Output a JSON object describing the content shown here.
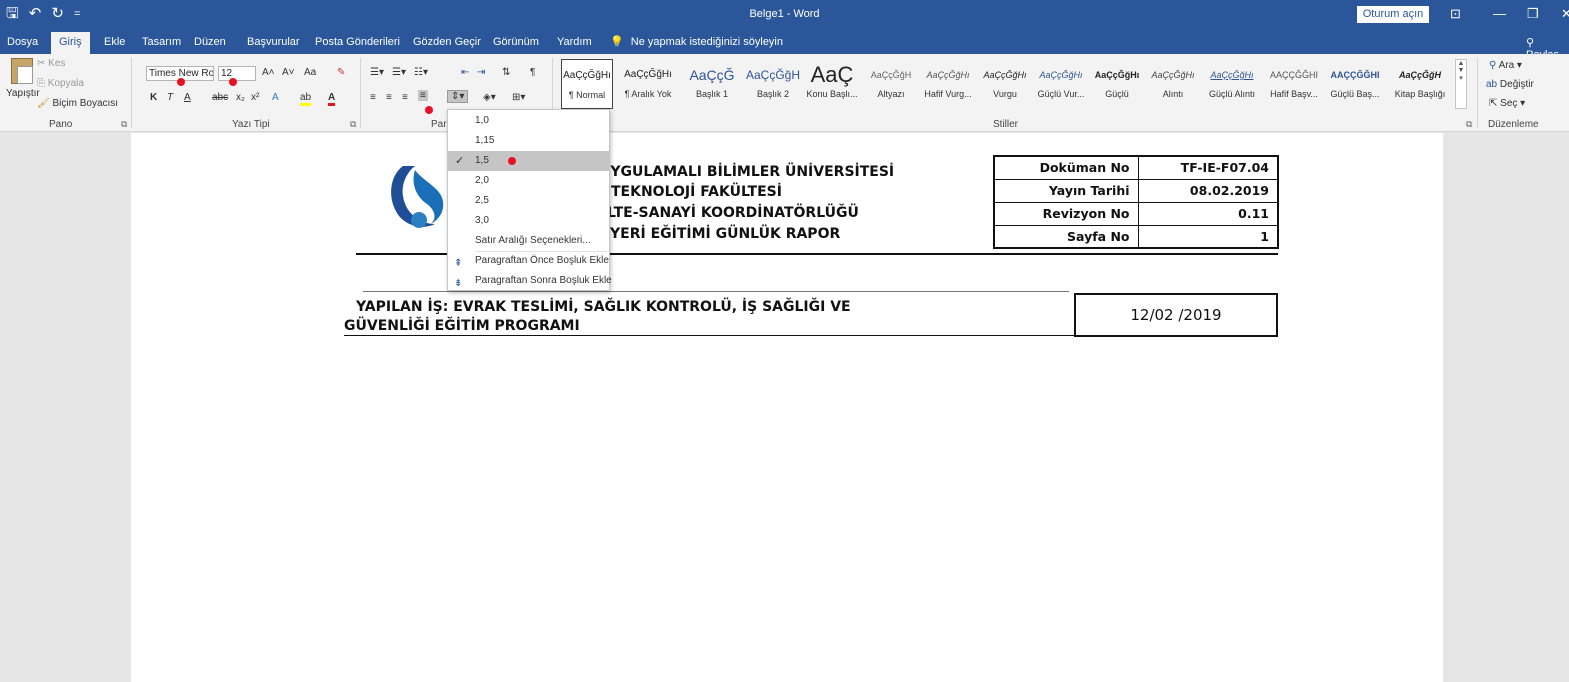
{
  "window": {
    "doc_title": "Belge1  -  Word",
    "signin_label": "Oturum açın",
    "qat": [
      "🖫",
      "↶",
      "↻",
      "="
    ],
    "controls": [
      "⊡",
      "—",
      "❐",
      "✕"
    ]
  },
  "tabs": {
    "items": [
      "Dosya",
      "Giriş",
      "Ekle",
      "Tasarım",
      "Düzen",
      "Başvurular",
      "Posta Gönderileri",
      "Gözden Geçir",
      "Görünüm",
      "Yardım"
    ],
    "active": "Giriş",
    "tell_me": "Ne yapmak istediğinizi söyleyin",
    "share": "Paylaş"
  },
  "clipboard": {
    "paste": "Yapıştır",
    "cut": "Kes",
    "copy": "Kopyala",
    "format_painter": "Biçim Boyacısı",
    "group": "Pano"
  },
  "font": {
    "name": "Times New Ro",
    "size": "12",
    "grow": "A˄",
    "shrink": "A˅",
    "change_case": "Aa",
    "clear": "✎",
    "bold": "K",
    "italic": "T",
    "underline": "A",
    "strike": "abc",
    "sub": "x₂",
    "sup": "x²",
    "effects": "A",
    "highlight": "ab",
    "color": "A",
    "group": "Yazı Tipi"
  },
  "paragraph": {
    "group": "Paragraf",
    "group_visible": "Para"
  },
  "styles": {
    "group": "Stiller",
    "items": [
      {
        "sample": "AaÇçĞğHı",
        "name": "¶ Normal"
      },
      {
        "sample": "AaÇçĞğHı",
        "name": "¶ Aralık Yok"
      },
      {
        "sample": "AaÇçĞ",
        "name": "Başlık 1"
      },
      {
        "sample": "AaÇçĞğH",
        "name": "Başlık 2"
      },
      {
        "sample": "AaÇ",
        "name": "Konu Başlı..."
      },
      {
        "sample": "AaÇçĞğH",
        "name": "Altyazı"
      },
      {
        "sample": "AaÇçĞğHı",
        "name": "Hafif Vurg..."
      },
      {
        "sample": "AaÇçĞğHı",
        "name": "Vurgu"
      },
      {
        "sample": "AaÇçĞğHı",
        "name": "Güçlü Vur..."
      },
      {
        "sample": "AaÇçĞğHı",
        "name": "Güçlü"
      },
      {
        "sample": "AaÇçĞğHı",
        "name": "Alıntı"
      },
      {
        "sample": "AaÇçĞğHı",
        "name": "Güçlü Alıntı"
      },
      {
        "sample": "AAÇÇĞĞHI",
        "name": "Hafif Başv..."
      },
      {
        "sample": "AAÇÇĞĞHI",
        "name": "Güçlü Baş..."
      },
      {
        "sample": "AaÇçĞğH",
        "name": "Kitap Başlığı"
      }
    ]
  },
  "editing": {
    "find": "Ara",
    "replace": "Değiştir",
    "select": "Seç",
    "group": "Düzenleme"
  },
  "line_spacing_menu": {
    "options": [
      "1,0",
      "1,15",
      "1,5",
      "2,0",
      "2,5",
      "3,0"
    ],
    "selected": "1,5",
    "more": "Satır Aralığı Seçenekleri...",
    "add_before": "Paragraftan Önce Boşluk Ekle",
    "add_after": "Paragraftan Sonra Boşluk Ekle"
  },
  "document": {
    "header_lines": [
      "UYGULAMALI BİLİMLER ÜNİVERSİTESİ",
      "TEKNOLOJİ FAKÜLTESİ",
      "LTE-SANAYİ KOORDİNATÖRLÜĞÜ",
      "YERİ EĞİTİMİ GÜNLÜK RAPOR"
    ],
    "info_table": [
      {
        "label": "Doküman No",
        "value": "TF-IE-F07.04"
      },
      {
        "label": "Yayın Tarihi",
        "value": "08.02.2019"
      },
      {
        "label": "Revizyon No",
        "value": "0.11"
      },
      {
        "label": "Sayfa No",
        "value": "1"
      }
    ],
    "work_line1": "YAPILAN İŞ: EVRAK TESLİMİ, SAĞLIK KONTROLÜ, İŞ SAĞLIĞI VE",
    "work_line2": "GÜVENLİĞİ EĞİTİM PROGRAMI",
    "date": "12/02 /2019"
  },
  "colors": {
    "brand": "#2b579a",
    "annotation": "#e81123"
  }
}
